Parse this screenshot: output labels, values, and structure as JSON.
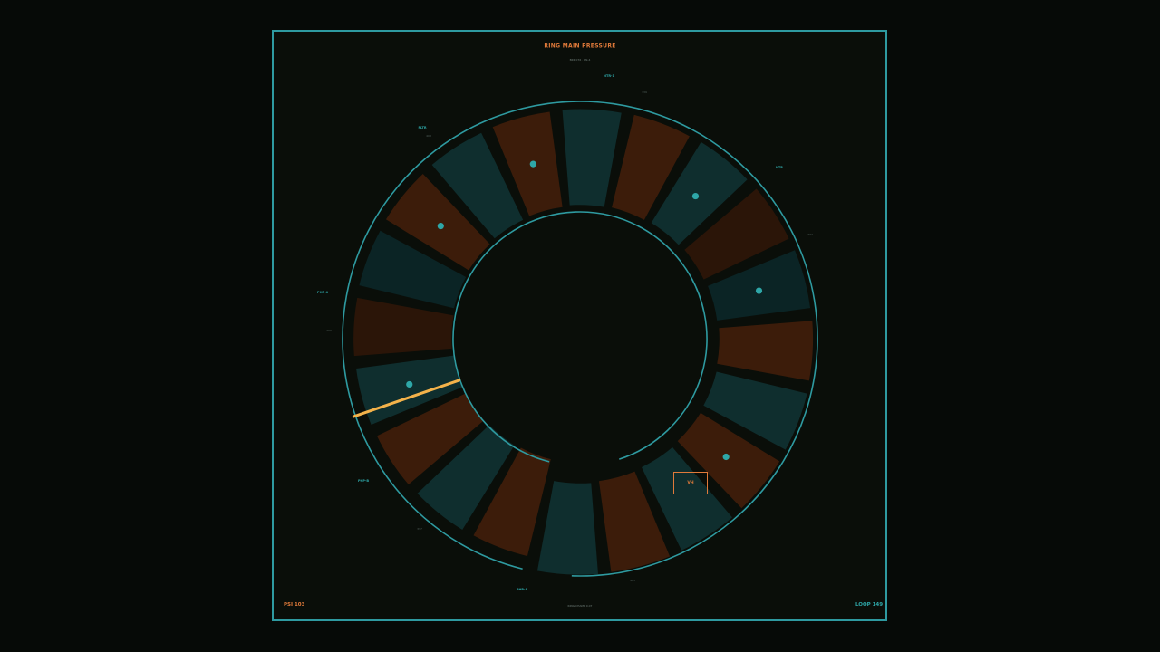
{
  "colors": {
    "background": "#060a07",
    "panel": "#0a0e09",
    "border": "#2e9aa0",
    "accent_orange": "#e07a3a",
    "highlight_yellow": "#f3b24a",
    "tile_teal": "#0f2e2e",
    "tile_teal_dark": "#0b2425",
    "tile_orange": "#3c1c0a",
    "tile_orange_dark": "#2b1508",
    "marker": "#2ea7a8"
  },
  "header": {
    "title": "RING MAIN PRESSURE",
    "subtitle": "BRP 076 · RN-4"
  },
  "zones": [
    {
      "tag": "NTR-1",
      "value": "339"
    },
    {
      "tag": "NTR",
      "value": "334"
    },
    {
      "tag": "PHP-A",
      "value": "403"
    },
    {
      "tag": "PHP-B",
      "value": "337"
    },
    {
      "tag": "PHP-4",
      "value": "400"
    },
    {
      "tag": "FLTR",
      "value": "403"
    }
  ],
  "segments": [
    {
      "tone": "orange",
      "marker": false
    },
    {
      "tone": "teal",
      "marker": false
    },
    {
      "tone": "orange",
      "marker": false
    },
    {
      "tone": "teal",
      "marker": true
    },
    {
      "tone": "orange_dark",
      "marker": false
    },
    {
      "tone": "teal_dark",
      "marker": false
    },
    {
      "tone": "orange",
      "marker": true
    },
    {
      "tone": "teal",
      "marker": false
    },
    {
      "tone": "orange",
      "marker": true
    },
    {
      "tone": "teal",
      "marker": false
    },
    {
      "tone": "orange",
      "marker": false
    },
    {
      "tone": "teal",
      "marker": true
    },
    {
      "tone": "orange_dark",
      "marker": false
    },
    {
      "tone": "teal_dark",
      "marker": true
    },
    {
      "tone": "orange",
      "marker": false
    },
    {
      "tone": "teal",
      "marker": false
    },
    {
      "tone": "orange",
      "marker": true
    },
    {
      "tone": "teal",
      "marker": false
    },
    {
      "tone": "orange",
      "marker": false
    },
    {
      "tone": "teal",
      "marker": false
    }
  ],
  "gauge": {
    "highlight_label": "pressure-needle"
  },
  "mode_button": {
    "label": "VH"
  },
  "footer": {
    "left": "PSI 103",
    "center": "RING CHAMP 0.07",
    "right": "LOOP 149"
  }
}
